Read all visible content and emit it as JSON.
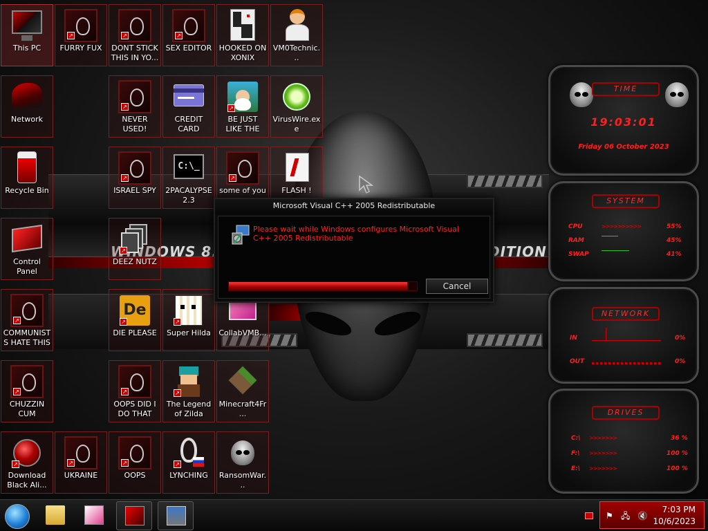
{
  "desktop": {
    "icons": [
      {
        "label": "This PC",
        "icon": "monitor-icon"
      },
      {
        "label": "FURRY FUX",
        "icon": "alienware-shortcut-icon"
      },
      {
        "label": "DONT STICK THIS IN YO...",
        "icon": "alienware-shortcut-icon"
      },
      {
        "label": "SEX EDITOR",
        "icon": "alienware-shortcut-icon"
      },
      {
        "label": "HOOKED ON XONIX",
        "icon": "xonix-game-icon"
      },
      {
        "label": "VM0Technic...",
        "icon": "technician-person-icon"
      },
      {
        "label": "Network",
        "icon": "network-icon"
      },
      {
        "label": "NEVER USED!",
        "icon": "alienware-shortcut-icon"
      },
      {
        "label": "CREDIT CARD CHECKER",
        "icon": "credit-card-icon"
      },
      {
        "label": "BE JUST LIKE THE DUDE!",
        "icon": "gnome-icon"
      },
      {
        "label": "VirusWire.exe",
        "icon": "lime-icon"
      },
      {
        "label": "Recycle Bin",
        "icon": "recycle-bin-icon"
      },
      {
        "label": "ISRAEL SPY",
        "icon": "alienware-shortcut-icon"
      },
      {
        "label": "2PACALYPSE 2.3",
        "icon": "terminal-icon"
      },
      {
        "label": "some of you",
        "icon": "alienware-shortcut-icon"
      },
      {
        "label": "FLASH !",
        "icon": "flash-icon"
      },
      {
        "label": "Control Panel",
        "icon": "control-panel-icon"
      },
      {
        "label": "DEEZ NUTZ",
        "icon": "stacked-windows-icon"
      },
      {
        "label": "COMMUNISTS HATE THIS G...",
        "icon": "alienware-shortcut-icon"
      },
      {
        "label": "DIE PLEASE",
        "icon": "die-icon"
      },
      {
        "label": "Super Hilda",
        "icon": "pixel-cat-icon"
      },
      {
        "label": "CollabVMB...",
        "icon": "collabvm-icon"
      },
      {
        "label": "CHUZZIN CUM",
        "icon": "alienware-shortcut-icon"
      },
      {
        "label": "OOPS DID I DO THAT",
        "icon": "alienware-shortcut-icon"
      },
      {
        "label": "The Legend of Zilda",
        "icon": "pixel-hero-icon"
      },
      {
        "label": "Minecraft4Fr...",
        "icon": "grass-block-icon"
      },
      {
        "label": "Download Black Ali...",
        "icon": "red-orb-icon"
      },
      {
        "label": "UKRAINE",
        "icon": "alienware-shortcut-icon"
      },
      {
        "label": "OOPS",
        "icon": "alienware-shortcut-icon"
      },
      {
        "label": "LYNCHING",
        "icon": "noose-icon"
      },
      {
        "label": "RansomWar...",
        "icon": "skull-icon"
      }
    ]
  },
  "wallpaper": {
    "title_left": "WINDOWS 8.1 BL",
    "title_right": "DITION 20"
  },
  "dialog": {
    "title": "Microsoft Visual C++ 2005 Redistributable",
    "message": "Please wait while Windows configures Microsoft Visual C++ 2005 Redistributable",
    "progress": 0.95,
    "cancel_label": "Cancel"
  },
  "gadgets": {
    "time": {
      "header": "TIME",
      "time": "19:03:01",
      "date": "Friday 06 October 2023"
    },
    "system": {
      "header": "SYSTEM",
      "rows": [
        {
          "label": "CPU",
          "value": "55%"
        },
        {
          "label": "RAM",
          "value": "45%"
        },
        {
          "label": "SWAP",
          "value": "41%"
        }
      ]
    },
    "network": {
      "header": "NETWORK",
      "rows": [
        {
          "label": "IN",
          "value": "0%"
        },
        {
          "label": "OUT",
          "value": "0%"
        }
      ]
    },
    "drives": {
      "header": "DRIVES",
      "rows": [
        {
          "label": "C:\\",
          "value": "36 %"
        },
        {
          "label": "F:\\",
          "value": "100 %"
        },
        {
          "label": "E:\\",
          "value": "100 %"
        }
      ]
    }
  },
  "taskbar": {
    "clock_time": "7:03 PM",
    "clock_date": "10/6/2023"
  },
  "colors": {
    "accent": "#cc0000",
    "text_red": "#ff1f1f"
  }
}
